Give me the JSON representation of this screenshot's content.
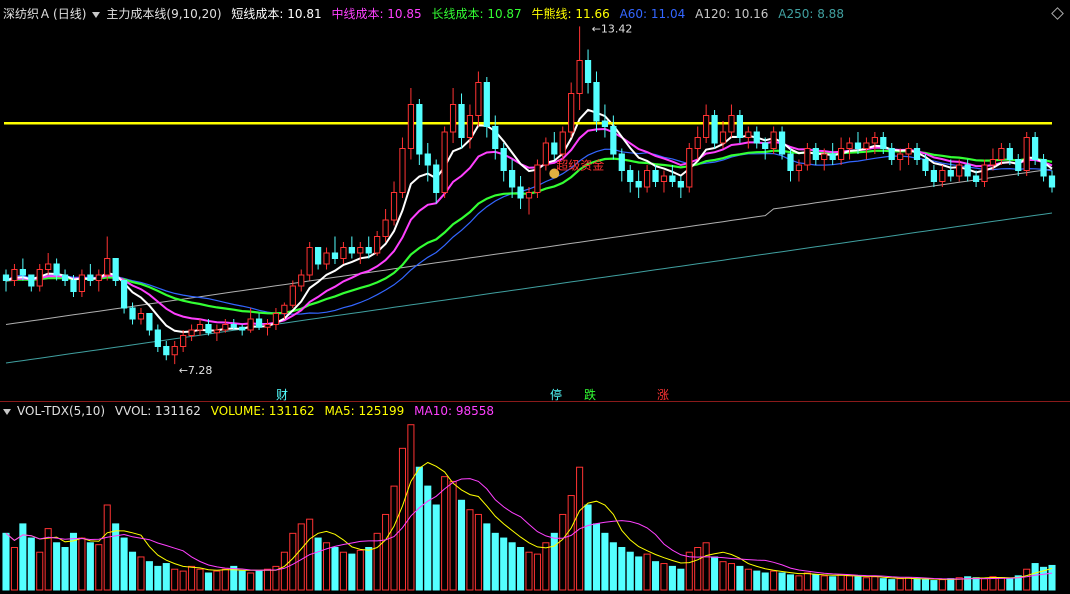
{
  "header": {
    "stock": "深纺织Ａ",
    "period": "(日线)",
    "indicator": "主力成本线(9,10,20)",
    "items": [
      {
        "label": "短线成本: 10.81",
        "color": "#ffffff"
      },
      {
        "label": "中线成本: 10.85",
        "color": "#ff40ff"
      },
      {
        "label": "长线成本: 10.87",
        "color": "#33ff33"
      },
      {
        "label": "牛熊线: 11.66",
        "color": "#ffff00"
      },
      {
        "label": "A60: 11.04",
        "color": "#3366ff"
      },
      {
        "label": "A120: 10.16",
        "color": "#c8c8c8"
      },
      {
        "label": "A250: 8.88",
        "color": "#40a0a0"
      }
    ]
  },
  "volume_header": {
    "name": "VOL-TDX(5,10)",
    "items": [
      {
        "label": "VVOL: 131162",
        "color": "#e0e0e0"
      },
      {
        "label": "VOLUME: 131162",
        "color": "#ffff00"
      },
      {
        "label": "MA5: 125199",
        "color": "#ffff00"
      },
      {
        "label": "MA10: 98558",
        "color": "#ff40ff"
      }
    ]
  },
  "annotations": {
    "high": "13.42",
    "low": "7.28",
    "money": "超级资金",
    "markers": [
      "财",
      "停",
      "跌",
      "涨"
    ]
  },
  "colors": {
    "up": "#ff3333",
    "down": "#54ffff",
    "short": "#ffffff",
    "mid": "#ff40ff",
    "long": "#33ff33",
    "bull": "#ffff00",
    "a60": "#3366ff",
    "a120": "#b0b0b0",
    "a250": "#40a0a0"
  },
  "chart_data": {
    "type": "candlestick",
    "price_range": [
      6.9,
      13.5
    ],
    "bull_bear_line": 11.66,
    "candles": [
      [
        8.9,
        9.0,
        8.6,
        8.8
      ],
      [
        8.8,
        9.1,
        8.7,
        9.0
      ],
      [
        9.0,
        9.2,
        8.8,
        8.9
      ],
      [
        8.9,
        8.9,
        8.6,
        8.7
      ],
      [
        8.7,
        9.1,
        8.6,
        9.0
      ],
      [
        9.0,
        9.3,
        8.9,
        9.1
      ],
      [
        9.1,
        9.2,
        8.8,
        8.9
      ],
      [
        8.9,
        9.0,
        8.7,
        8.8
      ],
      [
        8.8,
        8.9,
        8.5,
        8.6
      ],
      [
        8.6,
        9.0,
        8.5,
        8.9
      ],
      [
        8.9,
        9.1,
        8.7,
        8.8
      ],
      [
        8.8,
        9.0,
        8.6,
        8.9
      ],
      [
        8.9,
        9.6,
        8.8,
        9.2
      ],
      [
        9.2,
        9.2,
        8.7,
        8.8
      ],
      [
        8.8,
        8.8,
        8.2,
        8.3
      ],
      [
        8.3,
        8.4,
        8.0,
        8.1
      ],
      [
        8.1,
        8.3,
        8.0,
        8.2
      ],
      [
        8.2,
        8.2,
        7.8,
        7.9
      ],
      [
        7.9,
        8.0,
        7.5,
        7.6
      ],
      [
        7.6,
        7.7,
        7.35,
        7.45
      ],
      [
        7.45,
        7.7,
        7.28,
        7.6
      ],
      [
        7.6,
        7.9,
        7.5,
        7.8
      ],
      [
        7.8,
        8.0,
        7.7,
        7.9
      ],
      [
        7.9,
        8.1,
        7.8,
        8.0
      ],
      [
        8.0,
        8.1,
        7.8,
        7.85
      ],
      [
        7.85,
        8.0,
        7.7,
        7.9
      ],
      [
        7.9,
        8.1,
        7.85,
        8.0
      ],
      [
        8.0,
        8.1,
        7.9,
        7.95
      ],
      [
        7.95,
        8.0,
        7.8,
        7.9
      ],
      [
        7.9,
        8.3,
        7.85,
        8.1
      ],
      [
        8.1,
        8.2,
        7.9,
        7.95
      ],
      [
        7.95,
        8.1,
        7.8,
        8.0
      ],
      [
        8.0,
        8.3,
        7.9,
        8.2
      ],
      [
        8.2,
        8.4,
        8.1,
        8.35
      ],
      [
        8.35,
        8.8,
        8.3,
        8.7
      ],
      [
        8.7,
        9.0,
        8.6,
        8.9
      ],
      [
        8.9,
        9.5,
        8.8,
        9.4
      ],
      [
        9.4,
        9.4,
        9.0,
        9.1
      ],
      [
        9.1,
        9.4,
        9.0,
        9.3
      ],
      [
        9.3,
        9.6,
        9.1,
        9.2
      ],
      [
        9.2,
        9.5,
        9.1,
        9.4
      ],
      [
        9.4,
        9.6,
        9.2,
        9.3
      ],
      [
        9.3,
        9.5,
        9.1,
        9.4
      ],
      [
        9.4,
        9.6,
        9.2,
        9.3
      ],
      [
        9.3,
        9.7,
        9.25,
        9.6
      ],
      [
        9.6,
        10.1,
        9.5,
        9.9
      ],
      [
        9.9,
        10.6,
        9.8,
        10.4
      ],
      [
        10.4,
        11.4,
        10.3,
        11.2
      ],
      [
        11.2,
        12.3,
        11.0,
        12.0
      ],
      [
        12.0,
        12.1,
        10.9,
        11.1
      ],
      [
        11.1,
        11.3,
        10.6,
        10.9
      ],
      [
        10.9,
        11.0,
        10.2,
        10.4
      ],
      [
        10.4,
        11.6,
        10.3,
        11.5
      ],
      [
        11.5,
        12.3,
        11.3,
        12.0
      ],
      [
        12.0,
        12.2,
        11.2,
        11.4
      ],
      [
        11.4,
        12.0,
        11.2,
        11.8
      ],
      [
        11.8,
        12.6,
        11.6,
        12.4
      ],
      [
        12.4,
        12.5,
        11.4,
        11.6
      ],
      [
        11.6,
        11.8,
        11.0,
        11.2
      ],
      [
        11.2,
        11.3,
        10.6,
        10.8
      ],
      [
        10.8,
        11.0,
        10.3,
        10.5
      ],
      [
        10.5,
        10.7,
        10.1,
        10.3
      ],
      [
        10.3,
        10.5,
        10.0,
        10.4
      ],
      [
        10.4,
        11.0,
        10.3,
        10.9
      ],
      [
        10.9,
        11.4,
        10.8,
        11.3
      ],
      [
        11.3,
        11.5,
        11.0,
        11.1
      ],
      [
        11.1,
        11.6,
        11.0,
        11.5
      ],
      [
        11.5,
        12.4,
        11.4,
        12.2
      ],
      [
        12.2,
        13.42,
        11.9,
        12.8
      ],
      [
        12.8,
        13.0,
        12.2,
        12.4
      ],
      [
        12.4,
        12.6,
        11.5,
        11.7
      ],
      [
        11.7,
        12.0,
        11.4,
        11.6
      ],
      [
        11.6,
        11.8,
        11.0,
        11.1
      ],
      [
        11.1,
        11.2,
        10.6,
        10.8
      ],
      [
        10.8,
        10.9,
        10.4,
        10.6
      ],
      [
        10.6,
        10.8,
        10.3,
        10.5
      ],
      [
        10.5,
        10.9,
        10.4,
        10.8
      ],
      [
        10.8,
        10.9,
        10.5,
        10.6
      ],
      [
        10.6,
        10.8,
        10.4,
        10.7
      ],
      [
        10.7,
        10.9,
        10.5,
        10.6
      ],
      [
        10.6,
        10.7,
        10.3,
        10.5
      ],
      [
        10.5,
        11.3,
        10.4,
        11.2
      ],
      [
        11.2,
        11.6,
        11.0,
        11.4
      ],
      [
        11.4,
        12.0,
        11.3,
        11.8
      ],
      [
        11.8,
        11.9,
        11.2,
        11.3
      ],
      [
        11.3,
        11.7,
        11.2,
        11.5
      ],
      [
        11.5,
        12.0,
        11.4,
        11.8
      ],
      [
        11.8,
        11.9,
        11.3,
        11.4
      ],
      [
        11.4,
        11.6,
        11.2,
        11.5
      ],
      [
        11.5,
        11.6,
        11.2,
        11.3
      ],
      [
        11.3,
        11.4,
        11.0,
        11.2
      ],
      [
        11.2,
        11.6,
        11.1,
        11.5
      ],
      [
        11.5,
        11.6,
        11.0,
        11.1
      ],
      [
        11.1,
        11.2,
        10.6,
        10.8
      ],
      [
        10.8,
        11.0,
        10.6,
        10.9
      ],
      [
        10.9,
        11.3,
        10.8,
        11.2
      ],
      [
        11.2,
        11.3,
        10.9,
        11.0
      ],
      [
        11.0,
        11.2,
        10.8,
        11.1
      ],
      [
        11.1,
        11.3,
        10.9,
        11.0
      ],
      [
        11.0,
        11.4,
        10.9,
        11.2
      ],
      [
        11.2,
        11.4,
        11.0,
        11.3
      ],
      [
        11.3,
        11.5,
        11.1,
        11.2
      ],
      [
        11.2,
        11.4,
        11.0,
        11.3
      ],
      [
        11.3,
        11.5,
        11.1,
        11.4
      ],
      [
        11.4,
        11.5,
        11.1,
        11.2
      ],
      [
        11.2,
        11.3,
        10.9,
        11.0
      ],
      [
        11.0,
        11.2,
        10.8,
        11.1
      ],
      [
        11.1,
        11.3,
        10.9,
        11.2
      ],
      [
        11.2,
        11.3,
        10.9,
        11.0
      ],
      [
        11.0,
        11.1,
        10.7,
        10.8
      ],
      [
        10.8,
        10.9,
        10.5,
        10.6
      ],
      [
        10.6,
        10.9,
        10.5,
        10.8
      ],
      [
        10.8,
        11.0,
        10.6,
        10.7
      ],
      [
        10.7,
        11.0,
        10.6,
        10.9
      ],
      [
        10.9,
        11.0,
        10.6,
        10.7
      ],
      [
        10.7,
        10.8,
        10.5,
        10.6
      ],
      [
        10.6,
        11.0,
        10.5,
        10.9
      ],
      [
        10.9,
        11.2,
        10.8,
        11.0
      ],
      [
        11.0,
        11.3,
        10.9,
        11.2
      ],
      [
        11.2,
        11.3,
        10.9,
        11.0
      ],
      [
        11.0,
        11.1,
        10.7,
        10.8
      ],
      [
        10.8,
        11.5,
        10.7,
        11.4
      ],
      [
        11.4,
        11.5,
        10.9,
        11.0
      ],
      [
        11.0,
        11.1,
        10.6,
        10.7
      ],
      [
        10.7,
        10.8,
        10.4,
        10.5
      ]
    ],
    "volume_range": [
      0,
      180000
    ],
    "volumes": [
      60000,
      45000,
      70000,
      55000,
      40000,
      65000,
      50000,
      45000,
      60000,
      55000,
      50000,
      48000,
      90000,
      70000,
      55000,
      40000,
      35000,
      30000,
      25000,
      28000,
      22000,
      20000,
      25000,
      22000,
      18000,
      20000,
      22000,
      25000,
      20000,
      18000,
      20000,
      22000,
      25000,
      40000,
      60000,
      70000,
      75000,
      55000,
      50000,
      45000,
      40000,
      38000,
      42000,
      45000,
      60000,
      80000,
      110000,
      150000,
      175000,
      130000,
      110000,
      90000,
      120000,
      115000,
      95000,
      85000,
      80000,
      70000,
      60000,
      55000,
      50000,
      45000,
      40000,
      38000,
      50000,
      60000,
      80000,
      100000,
      130000,
      90000,
      70000,
      60000,
      50000,
      45000,
      40000,
      35000,
      38000,
      30000,
      28000,
      25000,
      22000,
      40000,
      45000,
      50000,
      35000,
      30000,
      28000,
      25000,
      22000,
      20000,
      18000,
      20000,
      18000,
      16000,
      15000,
      18000,
      16000,
      15000,
      14000,
      16000,
      15000,
      14000,
      13000,
      14000,
      12000,
      11000,
      12000,
      13000,
      12000,
      11000,
      10000,
      11000,
      12000,
      13000,
      14000,
      13000,
      12000,
      14000,
      13000,
      12000,
      15000,
      22000,
      28000,
      24000,
      26000
    ]
  }
}
